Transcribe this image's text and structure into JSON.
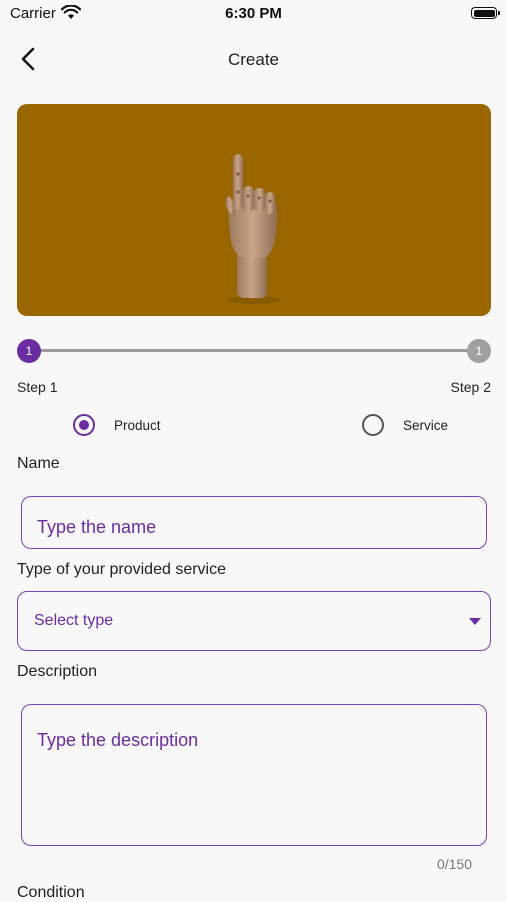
{
  "status_bar": {
    "carrier": "Carrier",
    "time": "6:30 PM"
  },
  "nav": {
    "title": "Create"
  },
  "hero": {
    "image_description": "wooden hand figure on mustard background",
    "background_color": "#9a6600"
  },
  "stepper": {
    "steps": [
      {
        "number": "1",
        "label": "Step 1",
        "active": true
      },
      {
        "number": "1",
        "label": "Step 2",
        "active": false
      }
    ],
    "active_color": "#6a2ca0",
    "inactive_color": "#a0a0a0"
  },
  "kind": {
    "options": [
      {
        "label": "Product",
        "selected": true
      },
      {
        "label": "Service",
        "selected": false
      }
    ]
  },
  "form": {
    "name_label": "Name",
    "name_placeholder": "Type the name",
    "type_label": "Type of your provided service",
    "type_placeholder": "Select type",
    "description_label": "Description",
    "description_placeholder": "Type the description",
    "description_counter": "0/150",
    "condition_label": "Condition"
  },
  "colors": {
    "accent": "#6a2ca0",
    "border": "#7a45b0"
  }
}
